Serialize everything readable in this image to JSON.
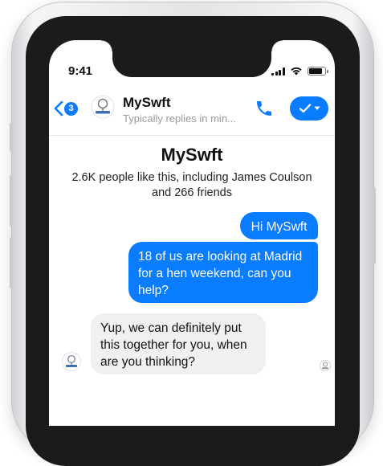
{
  "status": {
    "time": "9:41"
  },
  "header": {
    "unread_count": "3",
    "title": "MySwft",
    "subtitle": "Typically replies in min...",
    "avatar_icon": "myswft-logo-icon",
    "call_icon": "phone-icon",
    "manage_icon": "check-dropdown-icon"
  },
  "page": {
    "name": "MySwft",
    "likes": "2.6K people like this, including James Coulson and 266 friends"
  },
  "messages": [
    {
      "from": "me",
      "text": "Hi MySwft"
    },
    {
      "from": "me",
      "text": "18 of us are looking at Madrid for a hen weekend, can you help?"
    },
    {
      "from": "page",
      "text": "Yup, we can definitely put this together for you, when are you thinking?"
    }
  ],
  "colors": {
    "accent": "#0a7cff",
    "incoming_bubble": "#f0f0f0",
    "subtitle": "#9a9a9a"
  }
}
